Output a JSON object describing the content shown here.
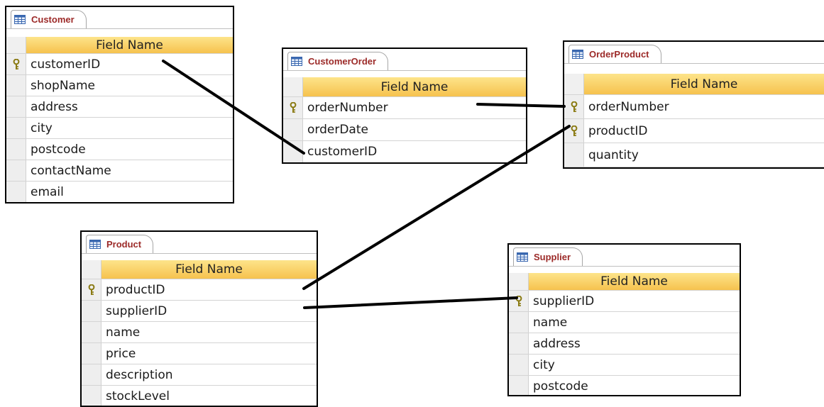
{
  "tables": {
    "customer": {
      "name": "Customer",
      "header": "Field Name",
      "fields": [
        "customerID",
        "shopName",
        "address",
        "city",
        "postcode",
        "contactName",
        "email"
      ]
    },
    "customer_order": {
      "name": "CustomerOrder",
      "header": "Field Name",
      "fields": [
        "orderNumber",
        "orderDate",
        "customerID"
      ]
    },
    "order_product": {
      "name": "OrderProduct",
      "header": "Field Name",
      "fields": [
        "orderNumber",
        "productID",
        "quantity"
      ]
    },
    "product": {
      "name": "Product",
      "header": "Field Name",
      "fields": [
        "productID",
        "supplierID",
        "name",
        "price",
        "description",
        "stockLevel"
      ]
    },
    "supplier": {
      "name": "Supplier",
      "header": "Field Name",
      "fields": [
        "supplierID",
        "name",
        "address",
        "city",
        "postcode"
      ]
    }
  },
  "icons": {
    "table": "table-icon",
    "primary_key": "key-icon"
  },
  "colors": {
    "table_name": "#9c2a28",
    "header_fill": "#f6c24e",
    "key": "#8a7a12",
    "relationship_line": "#000000"
  }
}
